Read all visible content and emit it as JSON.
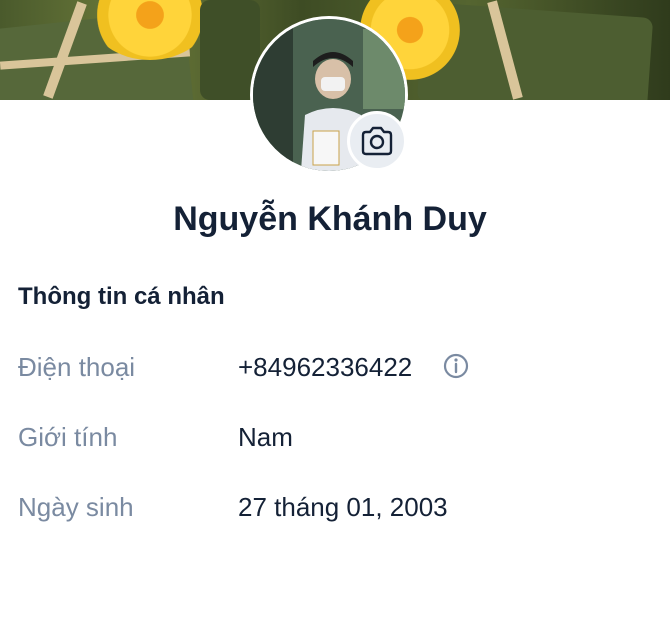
{
  "profile": {
    "name": "Nguyễn Khánh Duy"
  },
  "personal_info": {
    "title": "Thông tin cá nhân",
    "fields": [
      {
        "label": "Điện thoại",
        "value": "+84962336422"
      },
      {
        "label": "Giới tính",
        "value": "Nam"
      },
      {
        "label": "Ngày sinh",
        "value": "27 tháng 01, 2003"
      }
    ]
  },
  "icons": {
    "camera": "camera-icon",
    "info": "info-icon"
  },
  "colors": {
    "text_primary": "#142136",
    "text_label": "#7a8aa1",
    "camera_bg": "#e9edf2"
  }
}
